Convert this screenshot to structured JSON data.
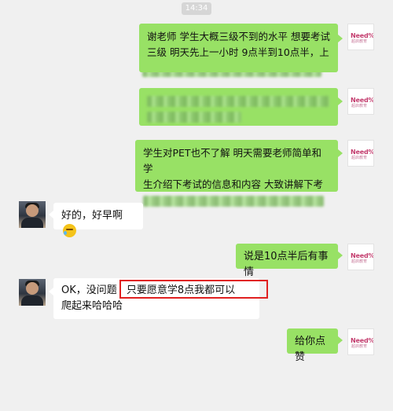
{
  "timestamp": "14:34",
  "brand": {
    "logo_text": "Need%",
    "logo_sub": "超启教育"
  },
  "messages": [
    {
      "sender": "me",
      "lines": [
        "谢老师 学生大概三级不到的水平 想要考试",
        "三级 明天先上一小时  9点半到10点半，上"
      ]
    },
    {
      "sender": "me",
      "lines": []
    },
    {
      "sender": "me",
      "lines": [
        "学生对PET也不了解 明天需要老师简单和学",
        "生介绍下考试的信息和内容  大致讲解下考"
      ]
    },
    {
      "sender": "other",
      "lines": [
        "好的，好早啊"
      ],
      "emoji": "laughing-tears-emoji"
    },
    {
      "sender": "me",
      "lines": [
        "说是10点半后有事情"
      ]
    },
    {
      "sender": "other",
      "lines": [
        "OK，没问题",
        "只要愿意学8点我都可以",
        "爬起来哈哈哈"
      ]
    },
    {
      "sender": "me",
      "lines": [
        "给你点赞"
      ]
    }
  ]
}
